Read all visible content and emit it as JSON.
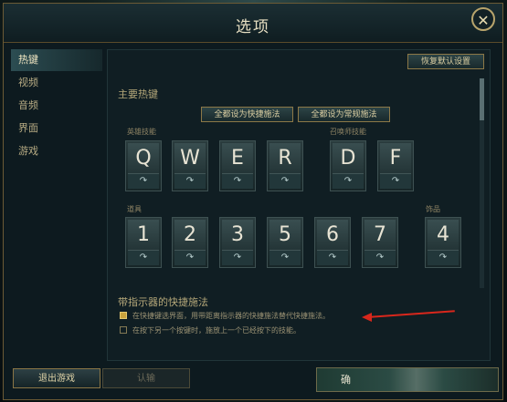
{
  "dialog": {
    "title": "选项",
    "close_glyph": "✕"
  },
  "sidebar": {
    "items": [
      {
        "label": "热键",
        "active": true
      },
      {
        "label": "视频"
      },
      {
        "label": "音频"
      },
      {
        "label": "界面"
      },
      {
        "label": "游戏"
      }
    ]
  },
  "toolbar": {
    "restore_defaults": "恢复默认设置"
  },
  "hotkeys": {
    "section_title": "主要热键",
    "set_all_quick": "全都设为快捷施法",
    "set_all_normal": "全都设为常规施法",
    "ability_label": "英雄技能",
    "summoner_label": "召唤师技能",
    "item_label": "道具",
    "trinket_label": "饰品",
    "abilities": [
      "Q",
      "W",
      "E",
      "R"
    ],
    "summoners": [
      "D",
      "F"
    ],
    "items": [
      "1",
      "2",
      "3",
      "5",
      "6",
      "7"
    ],
    "trinket": "4",
    "toggle_glyph": "↷"
  },
  "indicator": {
    "section_title": "带指示器的快捷施法",
    "option1": "在快捷键选界面，用带距离指示器的快捷施法替代快捷施法。",
    "option1_checked": true,
    "option2": "在按下另一个按键时，施放上一个已经按下的技能。",
    "option2_checked": false
  },
  "footer": {
    "exit_game": "退出游戏",
    "confirm": "认输",
    "accept_text": "确"
  },
  "colors": {
    "annotation_arrow": "#d8271c",
    "accent_gold": "#c9a23d"
  }
}
